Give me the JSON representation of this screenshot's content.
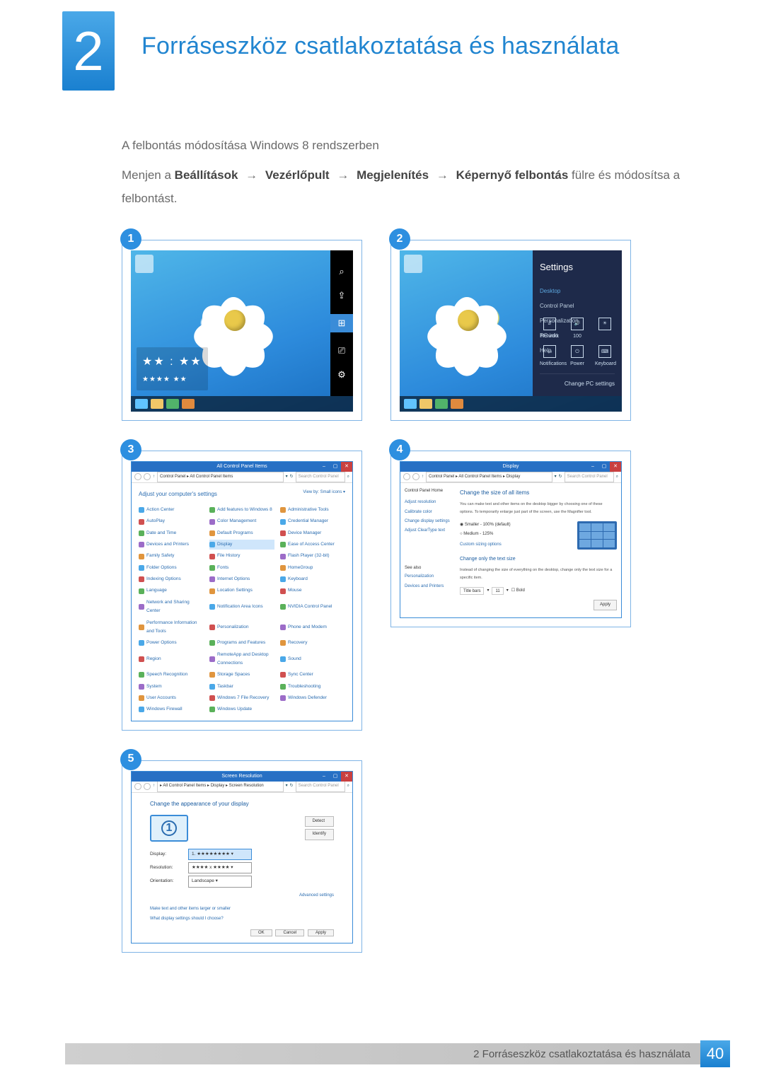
{
  "chapter": {
    "number": "2",
    "title": "Forráseszköz csatlakoztatása és használata"
  },
  "section": {
    "subheading": "A felbontás módosítása Windows 8 rendszerben",
    "instruction_lead": "Menjen a ",
    "path": {
      "p1": "Beállítások",
      "p2": "Vezérlőpult",
      "p3": "Megjelenítés",
      "p4": "Képernyő felbontás"
    },
    "instruction_tail": " fülre és módosítsa a felbontást.",
    "arrow": "→"
  },
  "badges": {
    "s1": "1",
    "s2": "2",
    "s3": "3",
    "s4": "4",
    "s5": "5"
  },
  "shot1": {
    "time": "★★ : ★★",
    "date": "★★★★  ★★",
    "charms": {
      "search": "⌕",
      "share": "⇪",
      "start": "⊞",
      "devices": "⎚",
      "settings": "⚙"
    }
  },
  "shot2": {
    "panel_title": "Settings",
    "items": {
      "desktop": "Desktop",
      "control": "Control Panel",
      "personal": "Personalization",
      "pcinfo": "PC info",
      "help": "Help"
    },
    "icons": {
      "network": "Network",
      "volume": "100",
      "bright": "Brightness",
      "notify": "Notifications",
      "power": "Power",
      "keyboard": "Keyboard"
    },
    "change": "Change PC settings"
  },
  "shot3": {
    "title": "All Control Panel Items",
    "crumbs": "Control Panel  ▸  All Control Panel Items",
    "search_ph": "Search Control Panel",
    "heading": "Adjust your computer's settings",
    "viewby": "View by:   Small icons ▾",
    "items": [
      "Action Center",
      "Add features to Windows 8",
      "Administrative Tools",
      "AutoPlay",
      "Color Management",
      "Credential Manager",
      "Date and Time",
      "Default Programs",
      "Device Manager",
      "Devices and Printers",
      "Display",
      "Ease of Access Center",
      "Family Safety",
      "File History",
      "Flash Player (32-bit)",
      "Folder Options",
      "Fonts",
      "HomeGroup",
      "Indexing Options",
      "Internet Options",
      "Keyboard",
      "Language",
      "Location Settings",
      "Mouse",
      "Network and Sharing Center",
      "Notification Area Icons",
      "NVIDIA Control Panel",
      "Performance Information and Tools",
      "Personalization",
      "Phone and Modem",
      "Power Options",
      "Programs and Features",
      "Recovery",
      "Region",
      "RemoteApp and Desktop Connections",
      "Sound",
      "Speech Recognition",
      "Storage Spaces",
      "Sync Center",
      "System",
      "Taskbar",
      "Troubleshooting",
      "User Accounts",
      "Windows 7 File Recovery",
      "Windows Defender",
      "Windows Firewall",
      "Windows Update",
      ""
    ],
    "highlight_index": 10
  },
  "shot4": {
    "title": "Display",
    "crumbs": "Control Panel  ▸  All Control Panel Items  ▸  Display",
    "search_ph": "Search Control Panel",
    "side": {
      "home": "Control Panel Home",
      "l1": "Adjust resolution",
      "l2": "Calibrate color",
      "l3": "Change display settings",
      "l4": "Adjust ClearType text",
      "seealso": "See also",
      "sa1": "Personalization",
      "sa2": "Devices and Printers"
    },
    "main": {
      "h1": "Change the size of all items",
      "p1": "You can make text and other items on the desktop bigger by choosing one of these options. To temporarily enlarge just part of the screen, use the Magnifier tool.",
      "r1": "Smaller - 100% (default)",
      "r2": "Medium - 125%",
      "custom": "Custom sizing options",
      "h2": "Change only the text size",
      "p2": "Instead of changing the size of everything on the desktop, change only the text size for a specific item.",
      "sel_label": "Title bars",
      "sel_size": "11",
      "bold": "Bold",
      "apply": "Apply"
    }
  },
  "shot5": {
    "title": "Screen Resolution",
    "crumbs": "▸ All Control Panel Items ▸ Display ▸ Screen Resolution",
    "search_ph": "Search Control Panel",
    "heading": "Change the appearance of your display",
    "mon": "1",
    "detect": "Detect",
    "identify": "Identify",
    "display_label": "Display:",
    "display_val": "1. ★★★★★★★★",
    "res_label": "Resolution:",
    "res_val": "★★★★ x ★★★★",
    "orient_label": "Orientation:",
    "orient_val": "Landscape",
    "advanced": "Advanced settings",
    "link1": "Make text and other items larger or smaller",
    "link2": "What display settings should I choose?",
    "ok": "OK",
    "cancel": "Cancel",
    "apply": "Apply"
  },
  "footer": {
    "text": "2 Forráseszköz csatlakoztatása és használata",
    "page": "40"
  }
}
